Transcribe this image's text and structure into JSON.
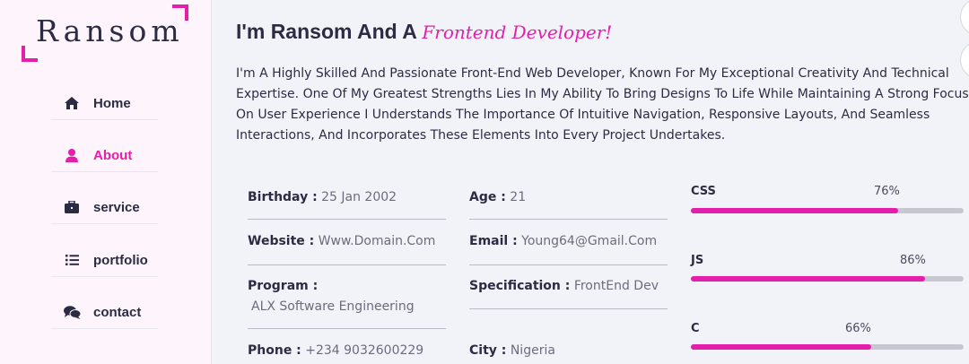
{
  "brand": {
    "logo": "Ransom"
  },
  "nav": [
    {
      "label": "Home",
      "icon": "home-icon"
    },
    {
      "label": "About",
      "icon": "user-icon",
      "active": true
    },
    {
      "label": "service",
      "icon": "briefcase-icon"
    },
    {
      "label": "portfolio",
      "icon": "list-icon"
    },
    {
      "label": "contact",
      "icon": "comments-icon"
    }
  ],
  "about": {
    "title_prefix": "I'm Ransom And A",
    "title_accent": "Frontend Developer!",
    "intro": "I'm A Highly Skilled And Passionate Front-End Web Developer, Known For My Exceptional Creativity And Technical Expertise. One Of My Greatest Strengths Lies In My Ability To Bring Designs To Life While Maintaining A Strong Focus On User Experience I Understands The Importance Of Intuitive Navigation, Responsive Layouts, And Seamless Interactions, And Incorporates These Elements Into Every Project Undertakes."
  },
  "info": {
    "birthday": {
      "label": "Birthday :",
      "value": "25 Jan 2002"
    },
    "age": {
      "label": "Age :",
      "value": "21"
    },
    "website": {
      "label": "Website :",
      "value": "Www.Domain.Com"
    },
    "email": {
      "label": "Email :",
      "value": "Young64@Gmail.Com"
    },
    "program": {
      "label": "Program :",
      "value": "ALX Software Engineering"
    },
    "specification": {
      "label": "Specification :",
      "value": "FrontEnd Dev"
    },
    "phone": {
      "label": "Phone :",
      "value": "+234 9032600229"
    },
    "city": {
      "label": "City :",
      "value": "Nigeria"
    }
  },
  "skills": [
    {
      "name": "CSS",
      "percent_label": "76%",
      "percent": 76
    },
    {
      "name": "JS",
      "percent_label": "86%",
      "percent": 86
    },
    {
      "name": "C",
      "percent_label": "66%",
      "percent": 66
    }
  ],
  "colors": {
    "accent": "#e41fab",
    "text": "#2b2c43",
    "track": "#c7c7cf"
  }
}
